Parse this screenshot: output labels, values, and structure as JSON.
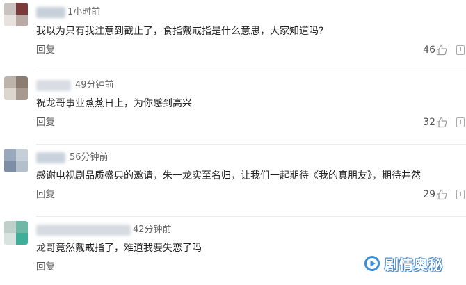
{
  "comments": [
    {
      "time": "1小时前",
      "text": "我以为只有我注意到截止了，食指戴戒指是什么意思，大家知道吗?",
      "reply_label": "回复",
      "likes": "46",
      "avatar_colors": [
        "#c9c2c0",
        "#7a3a3a",
        "#e8e2de",
        "#b9aaa5"
      ],
      "name_blur_color": "#c7d0da"
    },
    {
      "time": "49分钟前",
      "text": "祝龙哥事业蒸蒸日上，为你感到高兴",
      "reply_label": "回复",
      "likes": "32",
      "avatar_colors": [
        "#bdb3aa",
        "#8b7b70",
        "#ddd6cf",
        "#a89990"
      ],
      "name_blur_color": "#d9dde3"
    },
    {
      "time": "56分钟前",
      "text": "感谢电视剧品质盛典的邀请，朱一龙实至名归，让我们一起期待《我的真朋友》，期待井然",
      "reply_label": "回复",
      "likes": "29",
      "avatar_colors": [
        "#9aa8bb",
        "#c6ced8",
        "#7e8ea5",
        "#b4bfcc"
      ],
      "name_blur_color": "#c9d2dc"
    },
    {
      "time": "42分钟前",
      "text": "龙哥竟然戴戒指了，难道我要失恋了吗",
      "reply_label": "回复",
      "likes": "",
      "avatar_colors": [
        "#bfcfc9",
        "#6fb7a6",
        "#d8e3df",
        "#3fae98"
      ],
      "name_blur_color": "#d5dbe1"
    }
  ],
  "watermark": {
    "text": "剧情奥秘",
    "logo_color": "#3a8fd6"
  },
  "icons": {
    "like": "thumbs-up-icon",
    "report": "report-icon"
  }
}
